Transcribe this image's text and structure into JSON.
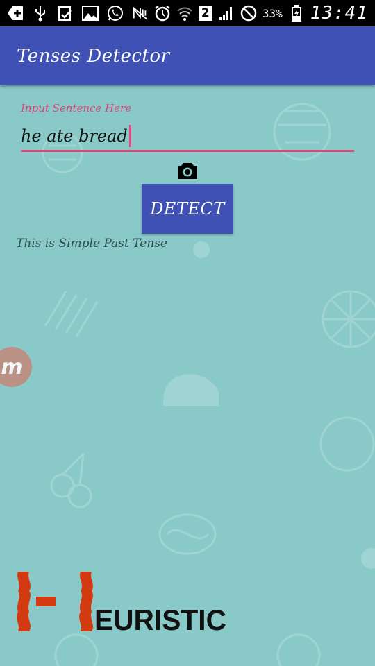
{
  "status_bar": {
    "battery_percent": "33%",
    "sim_slot": "2",
    "time": "13:41",
    "icons": [
      "add-icon",
      "usb-icon",
      "clipboard-check-icon",
      "image-icon",
      "whatsapp-icon",
      "nfc-mute-icon",
      "alarm-icon",
      "wifi-icon",
      "sim-icon",
      "signal-icon",
      "no-disturb-icon",
      "battery-icon"
    ]
  },
  "app_bar": {
    "title": "Tenses Detector"
  },
  "form": {
    "input_label": "Input Sentence Here",
    "input_value": "he ate bread",
    "camera_icon": "camera-icon",
    "detect_label": "DETECT"
  },
  "result": {
    "text": "This is Simple Past Tense"
  },
  "floating_button": {
    "label": "m"
  },
  "logo": {
    "text": "EURISTIC",
    "mark": "H"
  },
  "colors": {
    "background": "#89cac8",
    "primary": "#3f51b5",
    "accent": "#e0487c",
    "logo_red": "#d43a12"
  }
}
